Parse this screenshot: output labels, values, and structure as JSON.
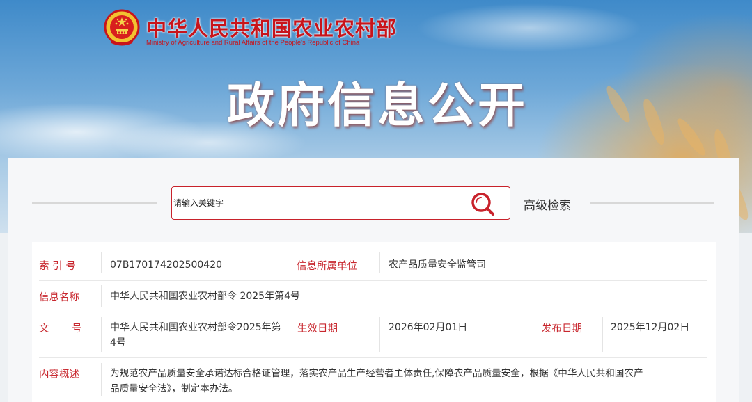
{
  "header": {
    "ministry_cn": "中华人民共和国农业农村部",
    "ministry_en": "Ministry of Agriculture and Rural Affairs of the People's Republic of China",
    "page_title": "政府信息公开",
    "emblem_icon": "national-emblem-icon"
  },
  "search": {
    "placeholder": "请输入关键字",
    "value": "",
    "button_icon": "search-icon",
    "advanced_label": "高级检索"
  },
  "info": {
    "index_label": "索 引 号",
    "index_value": "07B170174202500420",
    "unit_label": "信息所属单位",
    "unit_value": "农产品质量安全监管司",
    "name_label": "信息名称",
    "name_value": "中华人民共和国农业农村部令 2025年第4号",
    "doc_label": "文 号",
    "doc_value_line1": "中华人民共和国农业农村部令2025年第",
    "doc_value_line2": "4号",
    "effective_label": "生效日期",
    "effective_value": "2026年02月01日",
    "publish_label": "发布日期",
    "publish_value": "2025年12月02日",
    "summary_label": "内容概述",
    "summary_line1": "为规范农产品质量安全承诺达标合格证管理，落实农产品生产经营者主体责任,保障农产品质量安全，根据《中华人民共和国农产",
    "summary_line2": "品质量安全法》，制定本办法。"
  },
  "colors": {
    "accent_red": "#c8272e",
    "text": "#333333",
    "sky_blue": "#3f8ac9"
  }
}
